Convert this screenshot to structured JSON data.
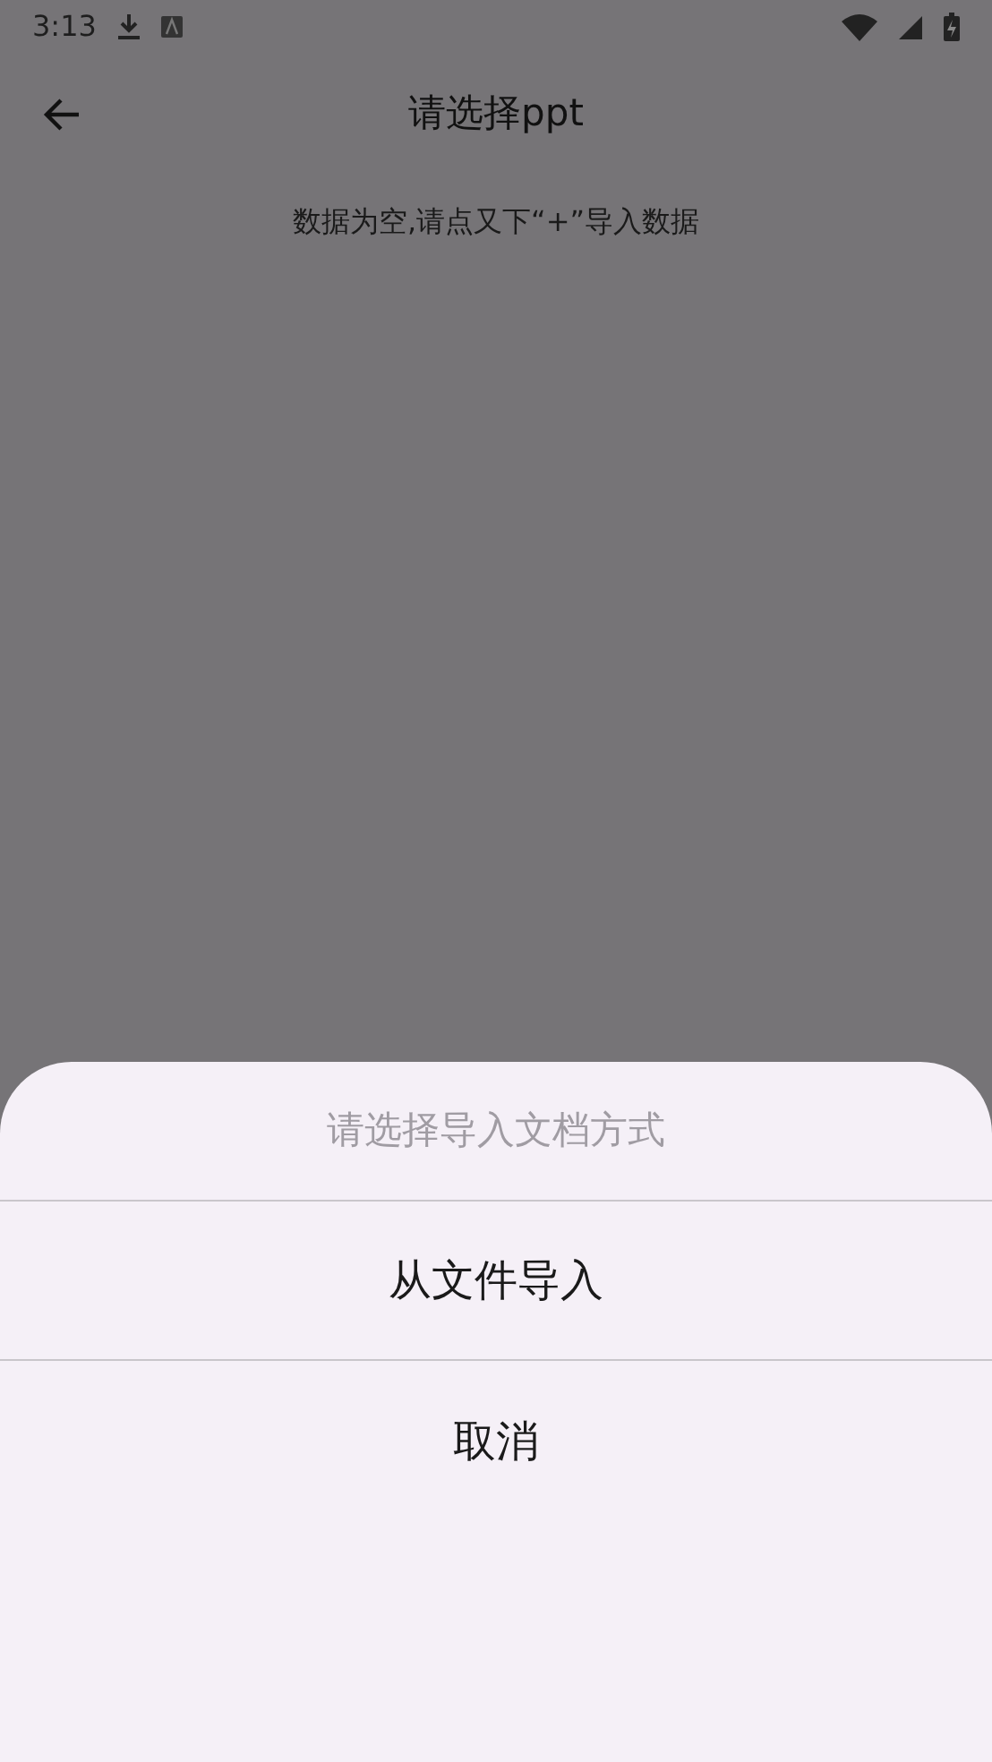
{
  "status_bar": {
    "time": "3:13"
  },
  "app_bar": {
    "title": "请选择ppt"
  },
  "empty_message": "数据为空,请点又下“+”导入数据",
  "sheet": {
    "title": "请选择导入文档方式",
    "options": [
      {
        "label": "从文件导入"
      },
      {
        "label": "取消"
      }
    ]
  }
}
